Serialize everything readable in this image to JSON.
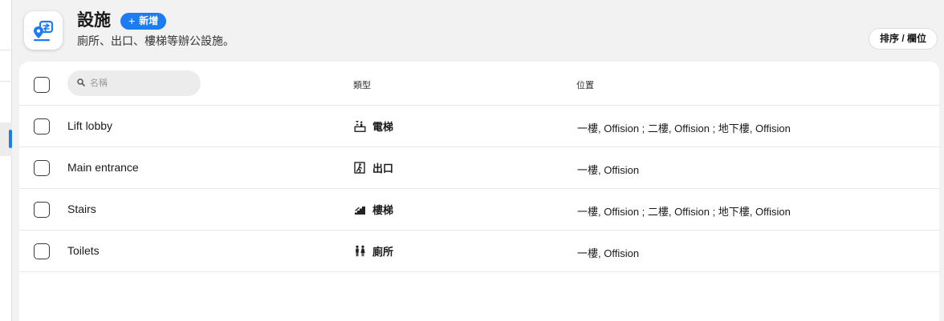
{
  "header": {
    "title": "設施",
    "add_label": "新增",
    "subtitle": "廁所、出口、樓梯等辦公設施。",
    "sort_label": "排序 / 欄位"
  },
  "table": {
    "search_placeholder": "名稱",
    "columns": {
      "type": "類型",
      "location": "位置"
    },
    "rows": [
      {
        "name": "Lift lobby",
        "type": "電梯",
        "type_icon": "elevator-icon",
        "location": "一樓, Offision ; 二樓, Offision ; 地下樓, Offision"
      },
      {
        "name": "Main entrance",
        "type": "出口",
        "type_icon": "exit-icon",
        "location": "一樓, Offision"
      },
      {
        "name": "Stairs",
        "type": "樓梯",
        "type_icon": "stairs-icon",
        "location": "一樓, Offision ; 二樓, Offision ; 地下樓, Offision"
      },
      {
        "name": "Toilets",
        "type": "廁所",
        "type_icon": "toilet-icon",
        "location": "一樓, Offision"
      }
    ]
  },
  "colors": {
    "accent": "#1d7cf2",
    "background": "#f2f2f2",
    "card": "#ffffff"
  },
  "icons": {
    "app": "facility-location-icon",
    "search": "search-icon"
  }
}
